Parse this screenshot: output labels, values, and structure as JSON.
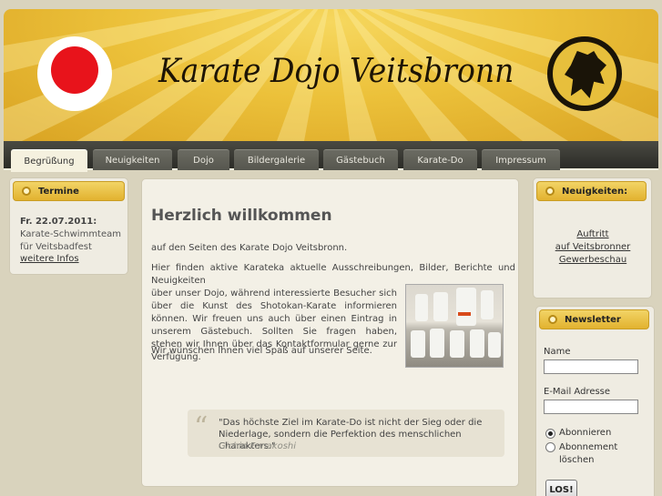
{
  "header": {
    "title": "Karate Dojo Veitsbronn"
  },
  "nav": {
    "tabs": [
      {
        "label": "Begrüßung",
        "active": true
      },
      {
        "label": "Neuigkeiten"
      },
      {
        "label": "Dojo"
      },
      {
        "label": "Bildergalerie"
      },
      {
        "label": "Gästebuch"
      },
      {
        "label": "Karate-Do"
      },
      {
        "label": "Impressum"
      }
    ]
  },
  "termine": {
    "title": "Termine",
    "date": "Fr. 22.07.2011:",
    "text": "Karate-Schwimmteam für Veitsbadfest",
    "link": "weitere Infos"
  },
  "main": {
    "heading": "Herzlich willkommen",
    "intro": "auf den Seiten des Karate Dojo Veitsbronn.",
    "para_first": "Hier finden aktive Karateka aktuelle Ausschreibungen, Bilder, Berichte und Neuigkeiten",
    "para_rest": "über unser Dojo, während interessierte Besucher sich über die Kunst des Shotokan-Karate informieren können. Wir freuen uns auch über einen Eintrag in unserem Gästebuch. Sollten Sie fragen haben, stehen wir Ihnen über das Kontaktformular gerne zur Verfügung.",
    "closing": "Wir wünschen Ihnen viel Spaß auf unserer Seite.",
    "quote": {
      "text": "\"Das höchste Ziel im Karate-Do ist nicht der Sieg oder die Niederlage, sondern die Perfektion des menschlichen Charakters.\"",
      "author": "Gichin Funakoshi"
    }
  },
  "news": {
    "title": "Neuigkeiten:",
    "links": [
      "Auftritt",
      "auf Veitsbronner",
      "Gewerbeschau"
    ]
  },
  "newsletter": {
    "title": "Newsletter",
    "name_label": "Name",
    "email_label": "E-Mail Adresse",
    "subscribe_label": "Abonnieren",
    "unsubscribe_label": "Abonnement löschen",
    "submit_label": "LOS!",
    "name_value": "",
    "email_value": ""
  },
  "colors": {
    "accent": "#e8b82f",
    "nav_bg": "#3a3a34",
    "page_bg": "#d9d3bd"
  }
}
